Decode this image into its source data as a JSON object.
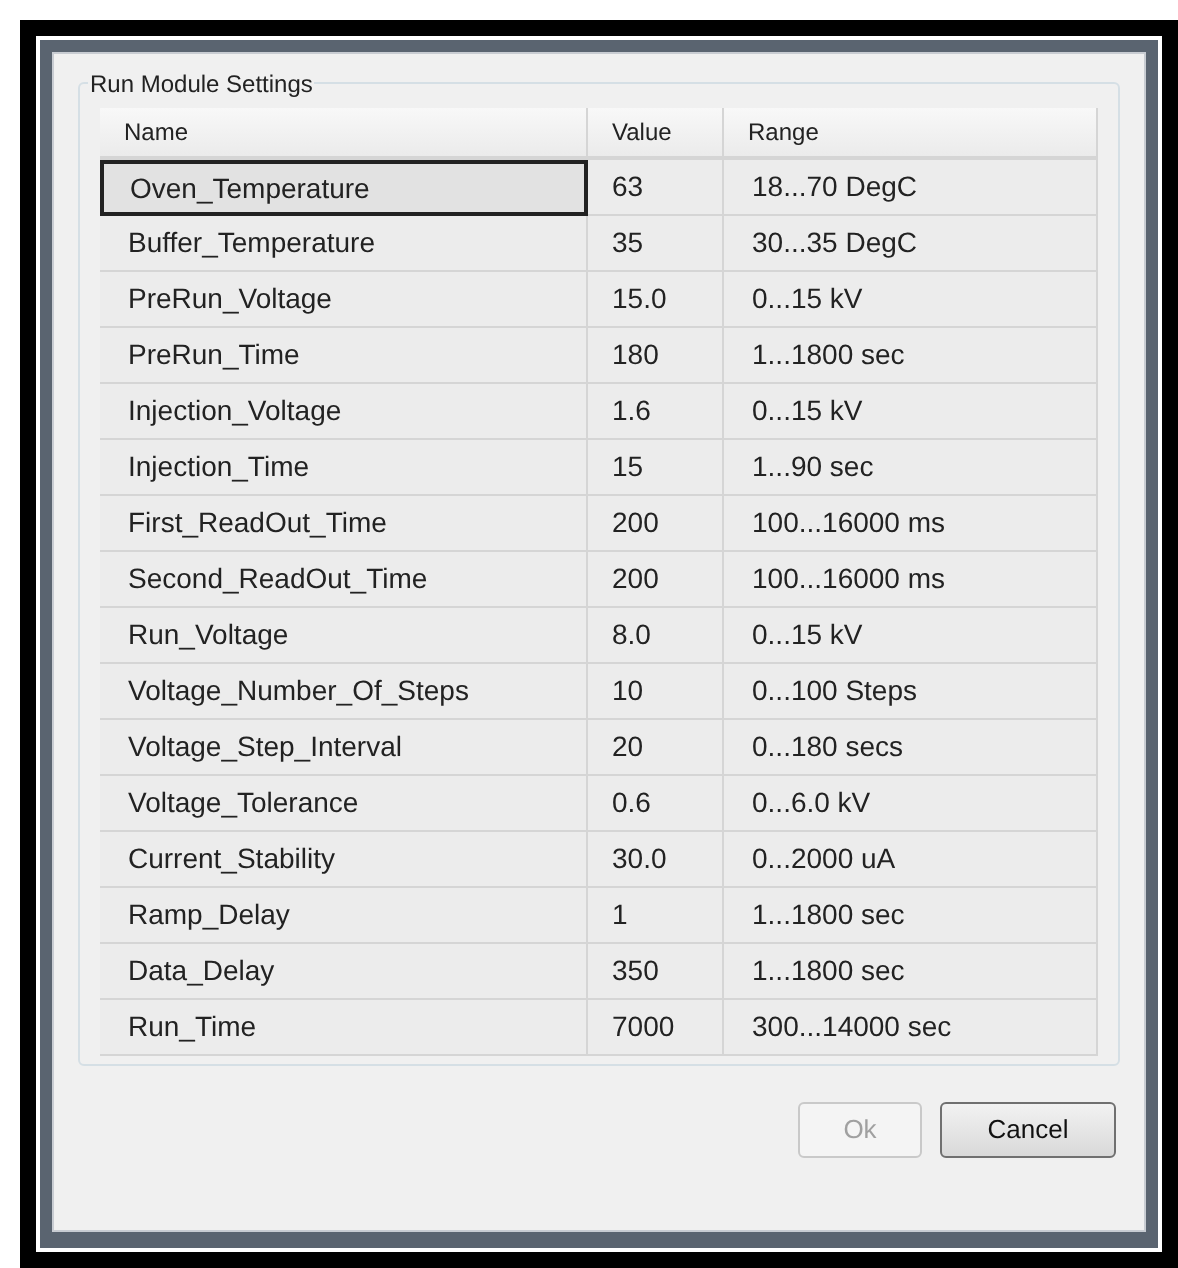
{
  "group_title": "Run Module Settings",
  "columns": [
    "Name",
    "Value",
    "Range"
  ],
  "rows": [
    {
      "name": "Oven_Temperature",
      "value": "63",
      "range": "18...70 DegC",
      "selected": true
    },
    {
      "name": "Buffer_Temperature",
      "value": "35",
      "range": "30...35 DegC",
      "selected": false
    },
    {
      "name": "PreRun_Voltage",
      "value": "15.0",
      "range": "0...15 kV",
      "selected": false
    },
    {
      "name": "PreRun_Time",
      "value": "180",
      "range": "1...1800 sec",
      "selected": false
    },
    {
      "name": "Injection_Voltage",
      "value": "1.6",
      "range": "0...15 kV",
      "selected": false
    },
    {
      "name": "Injection_Time",
      "value": "15",
      "range": "1...90 sec",
      "selected": false
    },
    {
      "name": "First_ReadOut_Time",
      "value": "200",
      "range": "100...16000 ms",
      "selected": false
    },
    {
      "name": "Second_ReadOut_Time",
      "value": "200",
      "range": "100...16000 ms",
      "selected": false
    },
    {
      "name": "Run_Voltage",
      "value": "8.0",
      "range": "0...15 kV",
      "selected": false
    },
    {
      "name": "Voltage_Number_Of_Steps",
      "value": "10",
      "range": "0...100 Steps",
      "selected": false
    },
    {
      "name": "Voltage_Step_Interval",
      "value": "20",
      "range": "0...180 secs",
      "selected": false
    },
    {
      "name": "Voltage_Tolerance",
      "value": "0.6",
      "range": "0...6.0 kV",
      "selected": false
    },
    {
      "name": "Current_Stability",
      "value": "30.0",
      "range": "0...2000 uA",
      "selected": false
    },
    {
      "name": "Ramp_Delay",
      "value": "1",
      "range": "1...1800 sec",
      "selected": false
    },
    {
      "name": "Data_Delay",
      "value": "350",
      "range": "1...1800 sec",
      "selected": false
    },
    {
      "name": "Run_Time",
      "value": "7000",
      "range": "300...14000 sec",
      "selected": false
    }
  ],
  "buttons": [
    {
      "label": "Ok",
      "disabled": true
    },
    {
      "label": "Cancel",
      "disabled": false
    }
  ]
}
